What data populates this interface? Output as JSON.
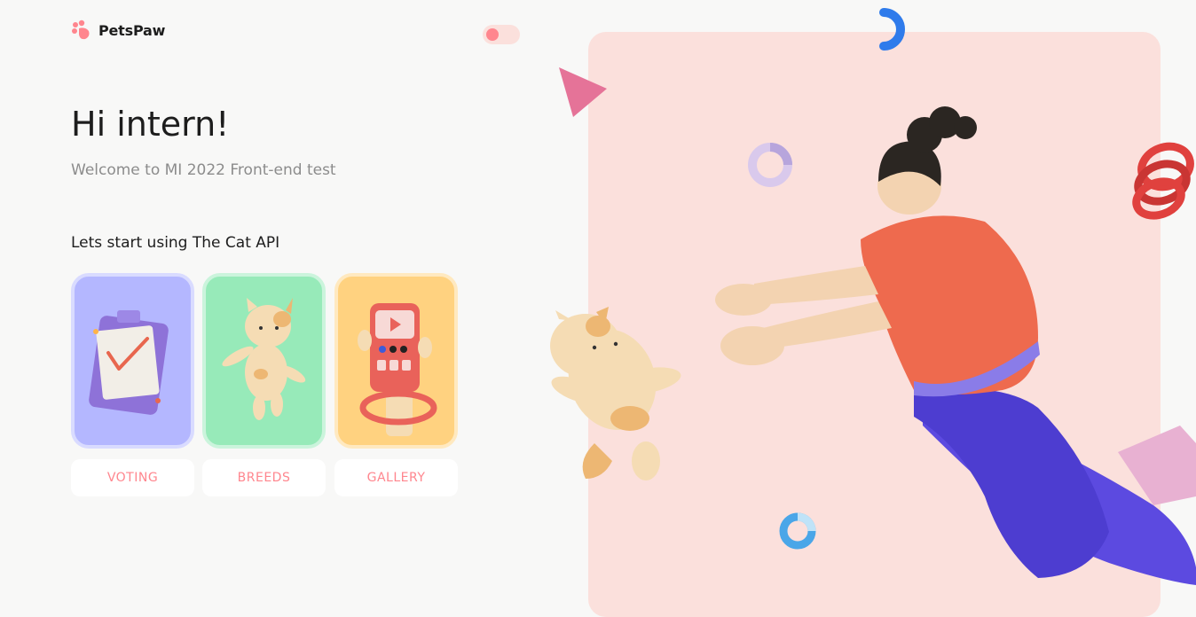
{
  "brand": {
    "name": "PetsPaw",
    "color": "#FF868E"
  },
  "theme_toggle": {
    "icon": "theme-toggle",
    "state": "off"
  },
  "greeting": {
    "title": "Hi intern!",
    "subtitle": "Welcome to MI 2022 Front-end test"
  },
  "section": {
    "title": "Lets start using The Cat API"
  },
  "cards": [
    {
      "label": "VOTING",
      "icon": "voting-clipboard-icon",
      "bg": "#B4B7FF",
      "border": "#D9DBFF"
    },
    {
      "label": "BREEDS",
      "icon": "breeds-cat-icon",
      "bg": "#97EAB9",
      "border": "#CBF4DC"
    },
    {
      "label": "GALLERY",
      "icon": "gallery-phone-icon",
      "bg": "#FFD280",
      "border": "#FFE9C0"
    }
  ],
  "hero": {
    "bg": "#FBE0DC",
    "illustration": "girl-reaching-for-cat"
  }
}
